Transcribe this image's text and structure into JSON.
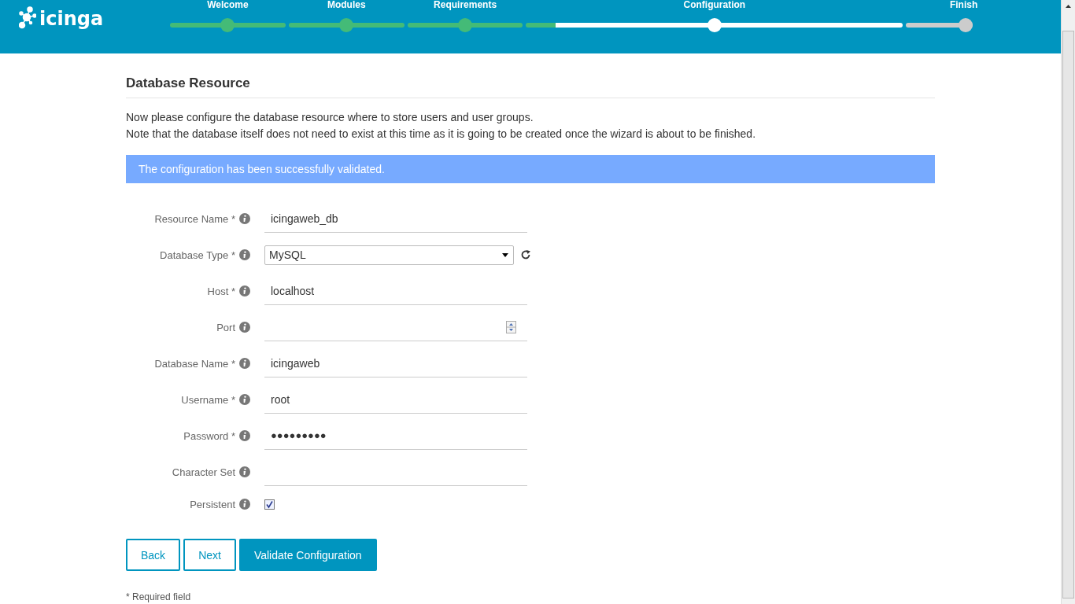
{
  "header": {
    "logo": "icinga"
  },
  "steps": [
    {
      "label": "Welcome",
      "completed": true,
      "selected": false
    },
    {
      "label": "Modules",
      "completed": true,
      "selected": false
    },
    {
      "label": "Requirements",
      "completed": true,
      "selected": false
    },
    {
      "label": "Configuration",
      "completed": false,
      "selected": true
    },
    {
      "label": "Finish",
      "completed": false,
      "selected": false
    }
  ],
  "title": "Database Resource",
  "intro": [
    "Now please configure the database resource where to store users and user groups.",
    "Note that the database itself does not need to exist at this time as it is going to be created once the wizard is about to be finished."
  ],
  "notice": "The configuration has been successfully validated.",
  "fields": [
    {
      "kind": "text",
      "label": "Resource Name *",
      "value": "icingaweb_db"
    },
    {
      "kind": "select",
      "label": "Database Type *",
      "value": "MySQL"
    },
    {
      "kind": "text",
      "label": "Host *",
      "value": "localhost"
    },
    {
      "kind": "number",
      "label": "Port"
    },
    {
      "kind": "text",
      "label": "Database Name *",
      "value": "icingaweb"
    },
    {
      "kind": "text",
      "label": "Username *",
      "value": "root"
    },
    {
      "kind": "password",
      "label": "Password *",
      "value": "●●●●●●●●●"
    },
    {
      "kind": "text",
      "label": "Character Set"
    },
    {
      "kind": "checkbox",
      "label": "Persistent",
      "checked": true
    }
  ],
  "buttons": [
    {
      "label": "Back",
      "kind": "outline"
    },
    {
      "label": "Next",
      "kind": "outline"
    },
    {
      "label": "Validate Configuration",
      "kind": "primary"
    }
  ],
  "footnote": "* Required field"
}
